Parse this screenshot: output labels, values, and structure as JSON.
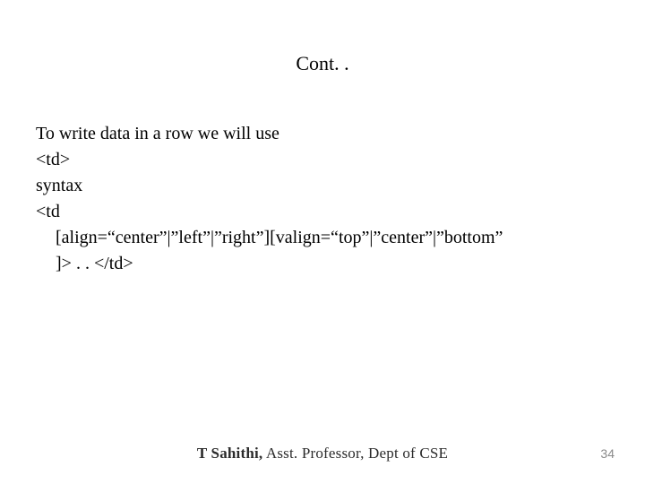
{
  "slide": {
    "title": "Cont. .",
    "body": {
      "line1": "To write data in a row we will use",
      "line2": "<td>",
      "line3": "syntax",
      "line4": "<td",
      "line5": "[align=“center”|”left”|”right”][valign=“top”|”center”|”bottom”",
      "line6": "]> . . </td>"
    },
    "footer": {
      "name": "T Sahithi,",
      "role": " Asst. Professor, Dept of CSE"
    },
    "page_number": "34"
  }
}
